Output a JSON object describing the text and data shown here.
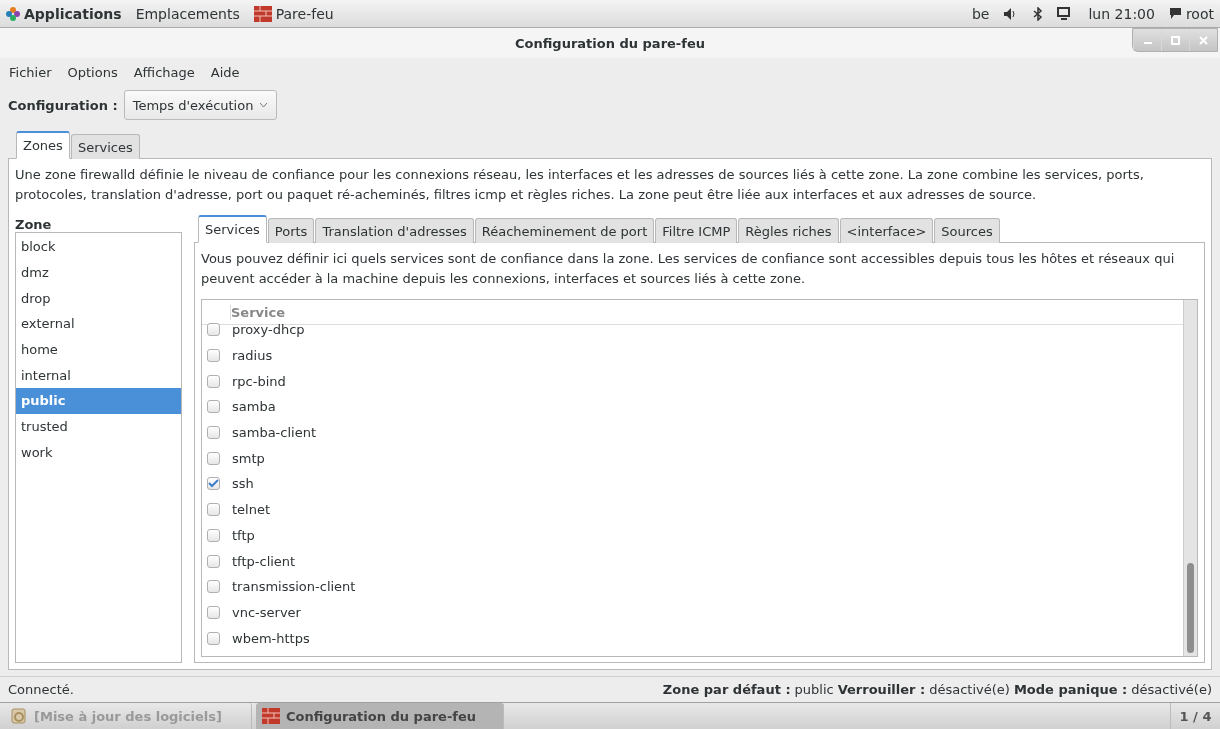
{
  "top_bar": {
    "applications": "Applications",
    "places": "Emplacements",
    "app": "Pare-feu",
    "keyboard": "be",
    "clock": "lun 21:00",
    "user": "root"
  },
  "window": {
    "title": "Configuration du pare-feu"
  },
  "menu": [
    "Fichier",
    "Options",
    "Affichage",
    "Aide"
  ],
  "configuration": {
    "label": "Configuration :",
    "value": "Temps d'exécution"
  },
  "tabs": [
    {
      "label": "Zones",
      "selected": true
    },
    {
      "label": "Services",
      "selected": false
    }
  ],
  "description": "Une zone firewalld définie le niveau de confiance pour les connexions réseau, les interfaces et les adresses de sources liés à cette zone. La zone combine les services, ports, protocoles, translation d'adresse, port ou paquet ré-acheminés, filtres icmp et règles riches. La zone peut être liée aux interfaces et aux adresses de source.",
  "zone_list": {
    "heading": "Zone",
    "items": [
      {
        "label": "block",
        "selected": false
      },
      {
        "label": "dmz",
        "selected": false
      },
      {
        "label": "drop",
        "selected": false
      },
      {
        "label": "external",
        "selected": false
      },
      {
        "label": "home",
        "selected": false
      },
      {
        "label": "internal",
        "selected": false
      },
      {
        "label": "public",
        "selected": true
      },
      {
        "label": "trusted",
        "selected": false
      },
      {
        "label": "work",
        "selected": false
      }
    ]
  },
  "zone_tabs": [
    {
      "label": "Services",
      "selected": true
    },
    {
      "label": "Ports",
      "selected": false
    },
    {
      "label": "Translation d'adresses",
      "selected": false
    },
    {
      "label": "Réacheminement de port",
      "selected": false
    },
    {
      "label": "Filtre ICMP",
      "selected": false
    },
    {
      "label": "Règles riches",
      "selected": false
    },
    {
      "label": "<interface>",
      "selected": false
    },
    {
      "label": "Sources",
      "selected": false
    }
  ],
  "services_description": "Vous pouvez définir ici quels services sont de confiance dans la zone. Les services de confiance sont accessibles depuis tous les hôtes et réseaux qui peuvent accéder à la machine depuis les connexions, interfaces et sources liés à cette zone.",
  "services_table": {
    "column": "Service",
    "rows": [
      {
        "name": "proxy-dhcp",
        "checked": false
      },
      {
        "name": "radius",
        "checked": false
      },
      {
        "name": "rpc-bind",
        "checked": false
      },
      {
        "name": "samba",
        "checked": false
      },
      {
        "name": "samba-client",
        "checked": false
      },
      {
        "name": "smtp",
        "checked": false
      },
      {
        "name": "ssh",
        "checked": true
      },
      {
        "name": "telnet",
        "checked": false
      },
      {
        "name": "tftp",
        "checked": false
      },
      {
        "name": "tftp-client",
        "checked": false
      },
      {
        "name": "transmission-client",
        "checked": false
      },
      {
        "name": "vnc-server",
        "checked": false
      },
      {
        "name": "wbem-https",
        "checked": false
      }
    ]
  },
  "status_bar": {
    "message": "Connecté.",
    "fields": [
      {
        "label": "Zone par défaut :",
        "value": "public"
      },
      {
        "label": "Verrouiller :",
        "value": "désactivé(e)"
      },
      {
        "label": "Mode panique :",
        "value": "désactivé(e)"
      }
    ]
  },
  "taskbar": {
    "items": [
      {
        "label": "[Mise à jour des logiciels]",
        "selected": false
      },
      {
        "label": "Configuration du pare-feu",
        "selected": true
      }
    ],
    "workspace": "1 / 4"
  }
}
